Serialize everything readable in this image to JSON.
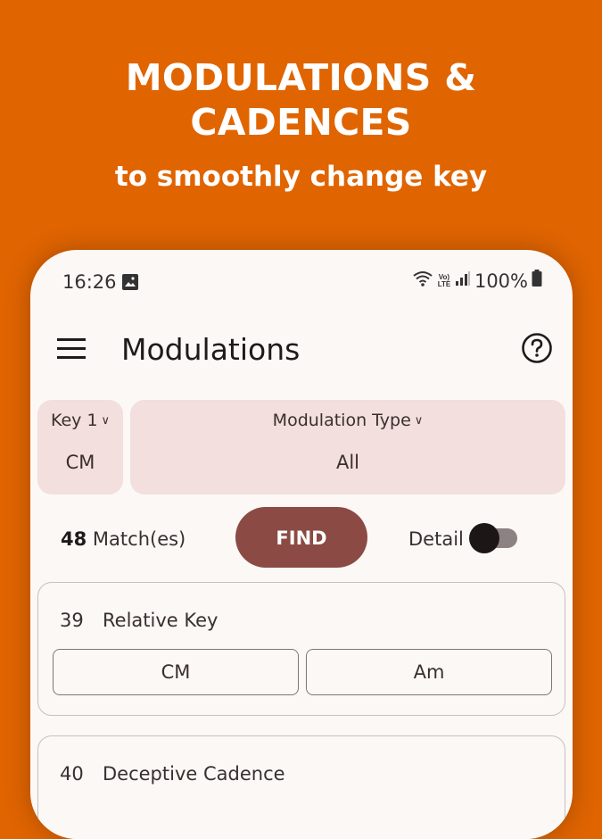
{
  "promo": {
    "title_line1": "MODULATIONS &",
    "title_line2": "CADENCES",
    "subtitle": "to smoothly change key"
  },
  "status_bar": {
    "time": "16:26",
    "battery": "100%",
    "network_label_top": "Vo)",
    "network_label_bottom": "LTE"
  },
  "app_bar": {
    "title": "Modulations"
  },
  "filters": {
    "key_label": "Key 1",
    "key_value": "CM",
    "type_label": "Modulation Type",
    "type_value": "All"
  },
  "actions": {
    "match_count": "48",
    "match_label": "Match(es)",
    "find_label": "FIND",
    "detail_label": "Detail",
    "detail_on": false
  },
  "results": [
    {
      "number": "39",
      "name": "Relative Key",
      "keys": [
        "CM",
        "Am"
      ]
    },
    {
      "number": "40",
      "name": "Deceptive Cadence",
      "keys": []
    }
  ],
  "colors": {
    "background": "#e06400",
    "surface": "#fcf8f6",
    "filter_card": "#f2dfde",
    "primary_button": "#8b4a44"
  }
}
